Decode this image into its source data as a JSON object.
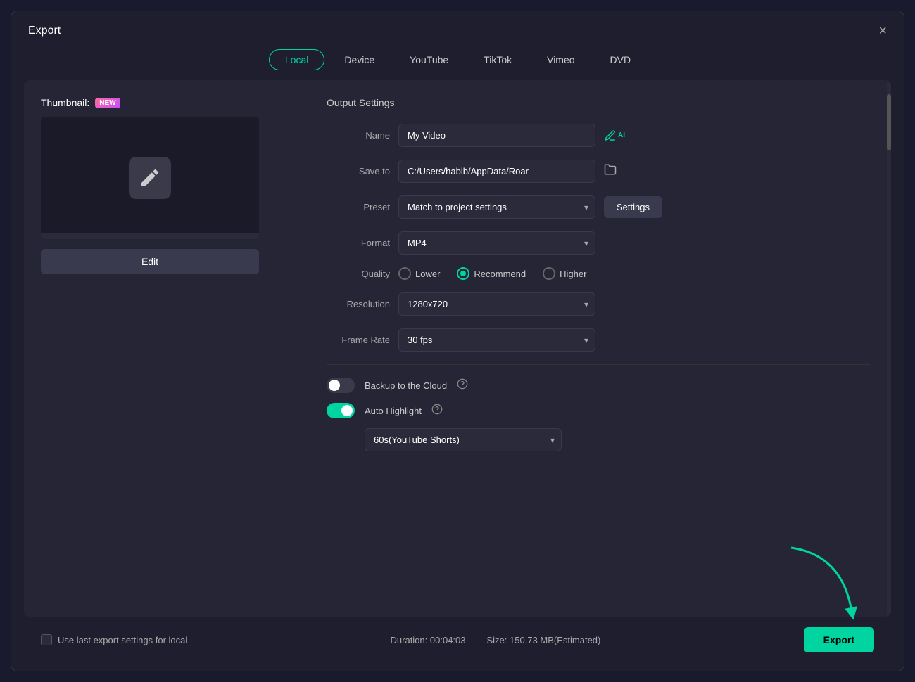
{
  "dialog": {
    "title": "Export",
    "close_label": "×"
  },
  "tabs": [
    {
      "id": "local",
      "label": "Local",
      "active": true
    },
    {
      "id": "device",
      "label": "Device",
      "active": false
    },
    {
      "id": "youtube",
      "label": "YouTube",
      "active": false
    },
    {
      "id": "tiktok",
      "label": "TikTok",
      "active": false
    },
    {
      "id": "vimeo",
      "label": "Vimeo",
      "active": false
    },
    {
      "id": "dvd",
      "label": "DVD",
      "active": false
    }
  ],
  "thumbnail": {
    "label": "Thumbnail:",
    "badge": "NEW",
    "edit_btn": "Edit"
  },
  "output_settings": {
    "title": "Output Settings",
    "name_label": "Name",
    "name_value": "My Video",
    "save_to_label": "Save to",
    "save_to_value": "C:/Users/habib/AppData/Roar",
    "preset_label": "Preset",
    "preset_value": "Match to project settings",
    "settings_btn": "Settings",
    "format_label": "Format",
    "format_value": "MP4",
    "quality_label": "Quality",
    "quality_options": [
      {
        "id": "lower",
        "label": "Lower",
        "active": false
      },
      {
        "id": "recommend",
        "label": "Recommend",
        "active": true
      },
      {
        "id": "higher",
        "label": "Higher",
        "active": false
      }
    ],
    "resolution_label": "Resolution",
    "resolution_value": "1280x720",
    "frame_rate_label": "Frame Rate",
    "frame_rate_value": "30 fps"
  },
  "toggles": [
    {
      "id": "backup",
      "label": "Backup to the Cloud",
      "state": "off",
      "has_help": true
    },
    {
      "id": "highlight",
      "label": "Auto Highlight",
      "state": "on",
      "has_help": true
    }
  ],
  "highlight_duration": {
    "value": "60s(YouTube Shorts)"
  },
  "footer": {
    "checkbox_label": "Use last export settings for local",
    "duration_label": "Duration:",
    "duration_value": "00:04:03",
    "size_label": "Size:",
    "size_value": "150.73 MB(Estimated)",
    "export_btn": "Export"
  }
}
